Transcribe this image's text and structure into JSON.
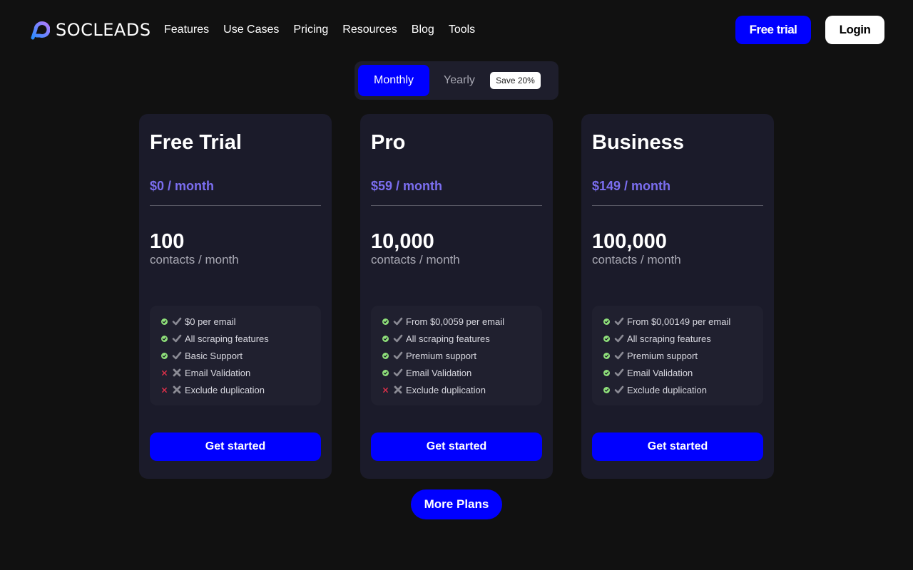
{
  "brand": {
    "name": "SOCLEADS",
    "accent": "#0000ff",
    "price_color": "#7b6ef0"
  },
  "nav": {
    "items": [
      "Features",
      "Use Cases",
      "Pricing",
      "Resources",
      "Blog",
      "Tools"
    ],
    "free_trial": "Free trial",
    "login": "Login"
  },
  "billing": {
    "monthly": "Monthly",
    "yearly": "Yearly",
    "save_badge": "Save 20%",
    "selected": "Monthly"
  },
  "plans": [
    {
      "title": "Free Trial",
      "price": "$0 / month",
      "contacts": "100",
      "contacts_unit": "contacts / month",
      "features": [
        {
          "text": "$0 per email",
          "included": true
        },
        {
          "text": "All scraping features",
          "included": true
        },
        {
          "text": "Basic Support",
          "included": true
        },
        {
          "text": "Email Validation",
          "included": false
        },
        {
          "text": "Exclude duplication",
          "included": false
        }
      ],
      "cta": "Get started"
    },
    {
      "title": "Pro",
      "price": "$59 / month",
      "contacts": "10,000",
      "contacts_unit": "contacts / month",
      "features": [
        {
          "text": "From $0,0059 per email",
          "included": true
        },
        {
          "text": "All scraping features",
          "included": true
        },
        {
          "text": "Premium support",
          "included": true
        },
        {
          "text": "Email Validation",
          "included": true
        },
        {
          "text": "Exclude duplication",
          "included": false
        }
      ],
      "cta": "Get started"
    },
    {
      "title": "Business",
      "price": "$149 / month",
      "contacts": "100,000",
      "contacts_unit": "contacts / month",
      "features": [
        {
          "text": "From $0,00149 per email",
          "included": true
        },
        {
          "text": "All scraping features",
          "included": true
        },
        {
          "text": "Premium support",
          "included": true
        },
        {
          "text": "Email Validation",
          "included": true
        },
        {
          "text": "Exclude duplication",
          "included": true
        }
      ],
      "cta": "Get started"
    }
  ],
  "more_plans": "More Plans"
}
